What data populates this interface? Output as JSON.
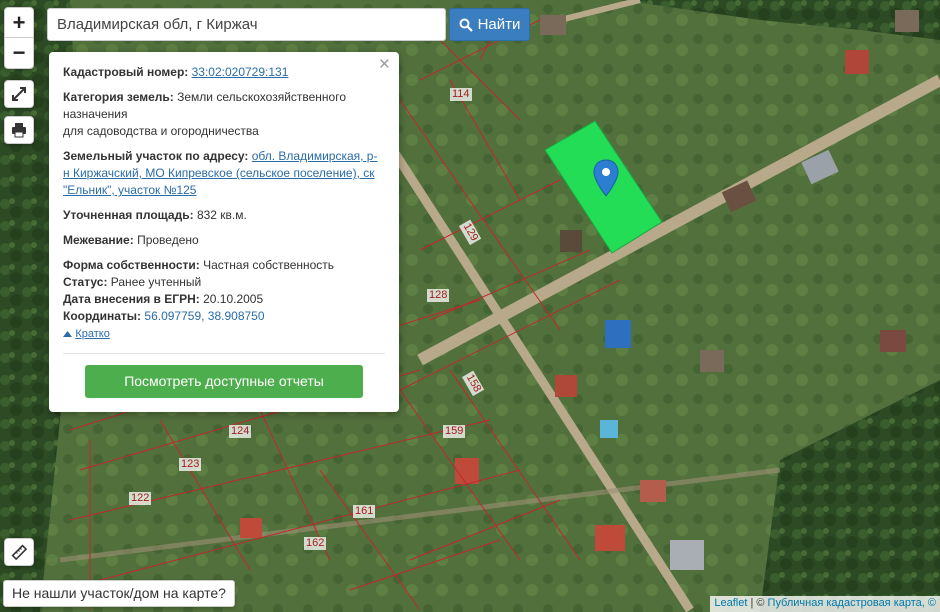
{
  "search": {
    "value": "Владимирская обл, г Киржач",
    "button_label": "Найти"
  },
  "controls": {
    "zoom_in": "+",
    "zoom_out": "−"
  },
  "popup": {
    "close": "×",
    "cadastral_label": "Кадастровый номер:",
    "cadastral_value": "33:02:020729:131",
    "category_label": "Категория земель:",
    "category_value_line1": "Земли сельскохозяйственного",
    "category_value_line2": "назначения",
    "category_value_line3": "для садоводства и огородничества",
    "address_label": "Земельный участок по адресу:",
    "address_value_line1": "обл. Владимирская, р-",
    "address_value_line2": "н Киржачский, МО Кипревское (сельское поселение), ск",
    "address_value_line3": "\"Ельник\", участок №125",
    "area_label": "Уточненная площадь:",
    "area_value": "832 кв.м.",
    "survey_label": "Межевание:",
    "survey_value": "Проведено",
    "ownership_label": "Форма собственности:",
    "ownership_value": "Частная собственность",
    "status_label": "Статус:",
    "status_value": "Ранее учтенный",
    "egrn_label": "Дата внесения в ЕГРН:",
    "egrn_value": "20.10.2005",
    "coords_label": "Координаты:",
    "coords_value": "56.097759, 38.908750",
    "toggle_label": "Кратко",
    "report_button": "Посмотреть доступные отчеты"
  },
  "plots": [
    {
      "id": "p114",
      "label": "114"
    },
    {
      "id": "p129",
      "label": "129"
    },
    {
      "id": "p128",
      "label": "128"
    },
    {
      "id": "p158",
      "label": "158"
    },
    {
      "id": "p159",
      "label": "159"
    },
    {
      "id": "p124",
      "label": "124"
    },
    {
      "id": "p123",
      "label": "123"
    },
    {
      "id": "p122",
      "label": "122"
    },
    {
      "id": "p161",
      "label": "161"
    },
    {
      "id": "p162",
      "label": "162"
    }
  ],
  "not_found": "Не нашли участок/дом на карте?",
  "attribution": {
    "leaflet": "Leaflet",
    "separator": " | © ",
    "source": "Публичная кадастровая карта, ©"
  },
  "colors": {
    "highlight": "#22dd55",
    "boundary": "#c0282d",
    "button": "#4cae4c",
    "search_button": "#3a7ec0"
  }
}
